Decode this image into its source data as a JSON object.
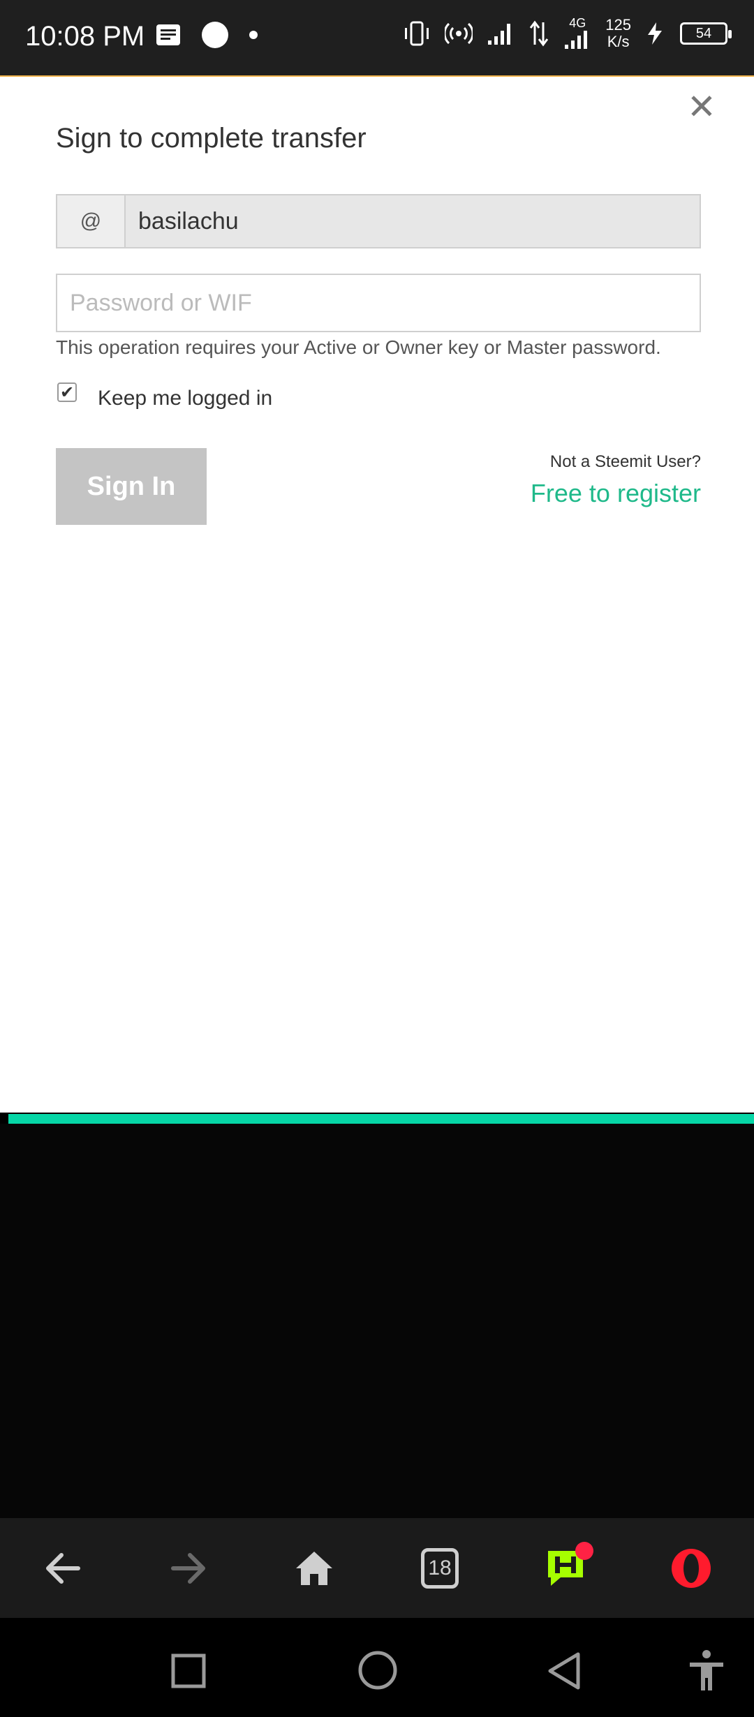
{
  "status_bar": {
    "time": "10:08 PM",
    "net_speed_value": "125",
    "net_speed_unit": "K/s",
    "network_type": "4G",
    "battery_level": "54"
  },
  "modal": {
    "title": "Sign to complete transfer",
    "at_symbol": "@",
    "username": "basilachu",
    "password_placeholder": "Password or WIF",
    "help_text": "This operation requires your Active or Owner key or Master password.",
    "keep_logged_in_label": "Keep me logged in",
    "keep_logged_in_checked": true,
    "sign_in_label": "Sign In",
    "not_user_text": "Not a Steemit User?",
    "register_link": "Free to register"
  },
  "toolbar": {
    "tab_count": "18"
  },
  "colors": {
    "accent_green": "#1fb98a",
    "teal_bar": "#06d6a6",
    "button_disabled": "#c4c4c4",
    "opera_red": "#ff1b2d",
    "message_icon_green": "#a6ff00"
  }
}
